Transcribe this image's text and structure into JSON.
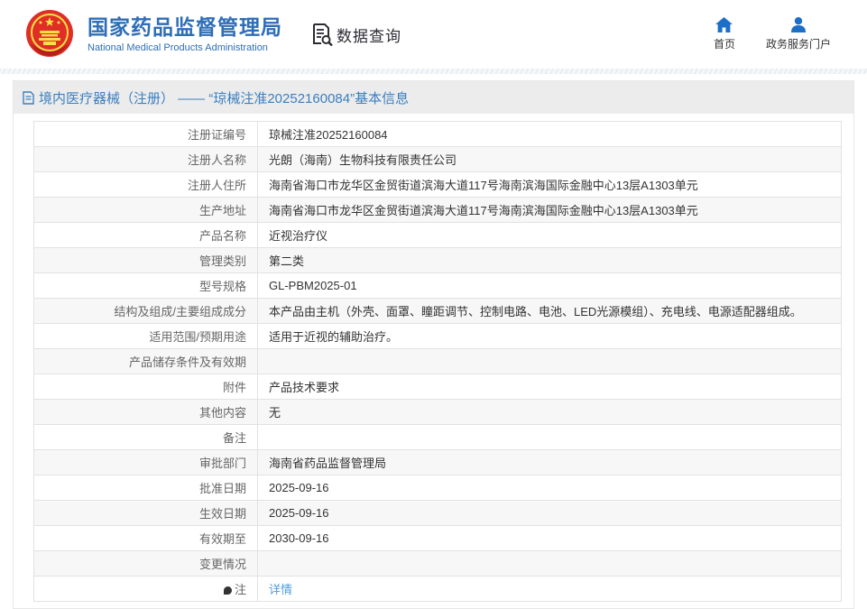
{
  "header": {
    "org_name_zh": "国家药品监督管理局",
    "org_name_en": "National Medical Products Administration",
    "section_label": "数据查询",
    "nav": [
      {
        "label": "首页"
      },
      {
        "label": "政务服务门户"
      }
    ]
  },
  "page": {
    "title": "境内医疗器械（注册） —— “琼械注准20252160084”基本信息"
  },
  "colors": {
    "brand_blue": "#2e6eb6",
    "title_blue": "#3a7fc1",
    "nav_icon_blue": "#1b6fc9",
    "link_blue": "#4f9cdd",
    "title_bar_bg": "#ececec",
    "stripe_bg": "#f7f7f7",
    "border": "#e2e2e2",
    "emblem_red": "#de2e26",
    "emblem_yellow": "#ffde45"
  },
  "table": {
    "rows": [
      {
        "label": "注册证编号",
        "value": "琼械注准20252160084",
        "type": "text"
      },
      {
        "label": "注册人名称",
        "value": "光朗（海南）生物科技有限责任公司",
        "type": "text"
      },
      {
        "label": "注册人住所",
        "value": "海南省海口市龙华区金贸街道滨海大道117号海南滨海国际金融中心13层A1303单元",
        "type": "text"
      },
      {
        "label": "生产地址",
        "value": "海南省海口市龙华区金贸街道滨海大道117号海南滨海国际金融中心13层A1303单元",
        "type": "text"
      },
      {
        "label": "产品名称",
        "value": "近视治疗仪",
        "type": "text"
      },
      {
        "label": "管理类别",
        "value": "第二类",
        "type": "text"
      },
      {
        "label": "型号规格",
        "value": "GL-PBM2025-01",
        "type": "text"
      },
      {
        "label": "结构及组成/主要组成成分",
        "value": "本产品由主机（外壳、面罩、瞳距调节、控制电路、电池、LED光源模组）、充电线、电源适配器组成。",
        "type": "text"
      },
      {
        "label": "适用范围/预期用途",
        "value": "适用于近视的辅助治疗。",
        "type": "text"
      },
      {
        "label": "产品储存条件及有效期",
        "value": "",
        "type": "text"
      },
      {
        "label": "附件",
        "value": "产品技术要求",
        "type": "text"
      },
      {
        "label": "其他内容",
        "value": "无",
        "type": "text"
      },
      {
        "label": "备注",
        "value": "",
        "type": "text"
      },
      {
        "label": "审批部门",
        "value": "海南省药品监督管理局",
        "type": "text"
      },
      {
        "label": "批准日期",
        "value": "2025-09-16",
        "type": "text"
      },
      {
        "label": "生效日期",
        "value": "2025-09-16",
        "type": "text"
      },
      {
        "label": "有效期至",
        "value": "2030-09-16",
        "type": "text"
      },
      {
        "label": "变更情况",
        "value": "",
        "type": "text"
      },
      {
        "label": "注",
        "value": "详情",
        "type": "link",
        "pin": true
      }
    ]
  }
}
